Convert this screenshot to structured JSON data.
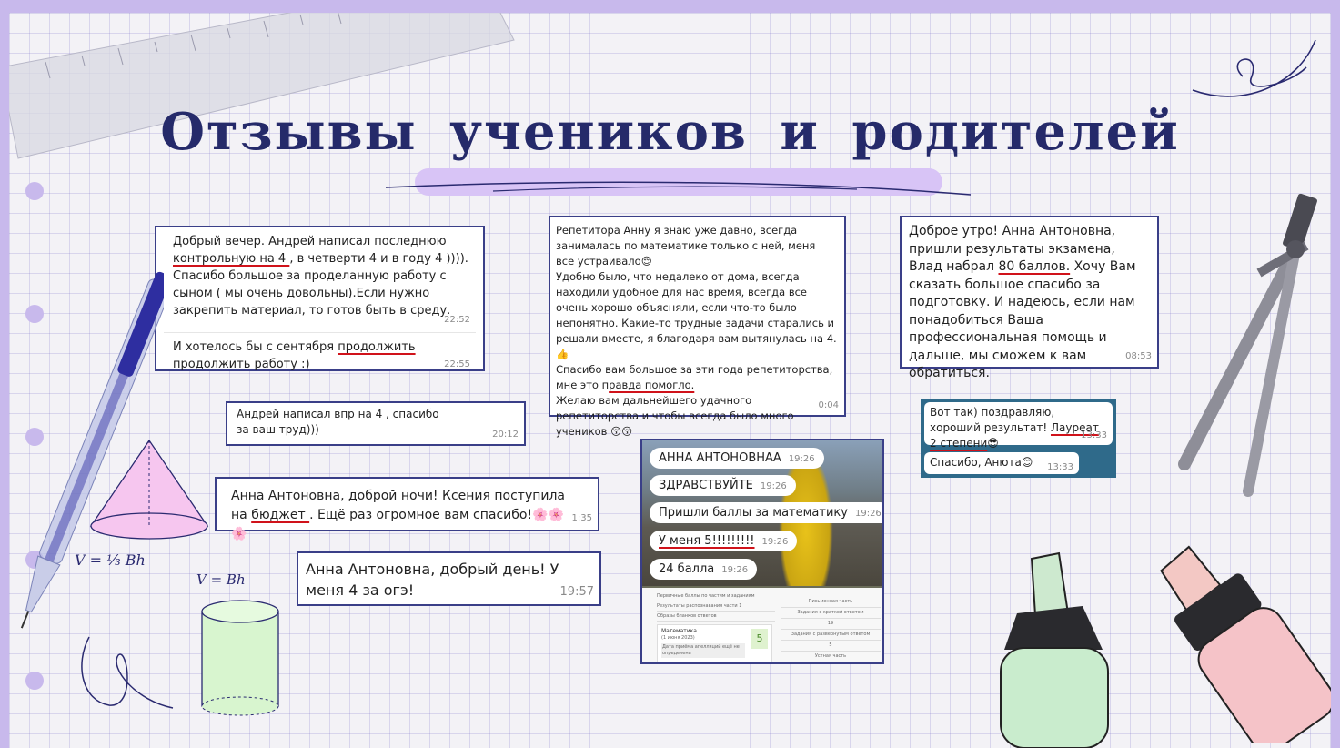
{
  "title": "Отзывы учеников и родителей",
  "formulas": {
    "cone": "V = ⅓ Bh",
    "cylinder": "V = Bh"
  },
  "reviews": {
    "r1": {
      "part1": "Добрый вечер. Андрей написал последнюю ",
      "underlined": "контрольную на 4 ",
      "part2": ", в четверти 4 и в году 4 )))).",
      "part3": "Спасибо большое за проделанную работу с сыном ( мы очень довольны).Если нужно закрепить материал, то готов быть в среду.",
      "time": "22:52"
    },
    "r1b": {
      "part1": "И хотелось бы с сентября ",
      "underlined": "продолжить",
      "part2": "продолжить работу :)",
      "time": "22:55"
    },
    "r2": {
      "text": "Андрей написал впр на 4 , спасибо за ваш труд)))",
      "time": "20:12"
    },
    "r3": {
      "part1": "Анна Антоновна, доброй ночи! Ксения поступила на ",
      "underlined": "бюджет ",
      "part2": ". Ещё раз огромное вам спасибо!🌸🌸🌸",
      "time": "1:35"
    },
    "r4": {
      "text": "Анна Антоновна, добрый день! У меня 4 за огэ!",
      "time": "19:57"
    },
    "r5": {
      "part1": "Репетитора Анну я знаю уже давно, всегда занималась по математике только с ней, меня все устраивало😌",
      "part2": "Удобно было, что недалеко от дома, всегда находили удобное для нас время, всегда все очень хорошо объясняли, если что-то было непонятно. Какие-то трудные задачи старались и решали вместе, я благодаря вам вытянулась на 4. 👍",
      "part3": "Спасибо вам большое за эти года репетиторства, мне это п",
      "underlined": "равда помогло.",
      "part4": "Желаю вам дальнейшего удачного репетиторства и чтобы всегда было много учеников 😚😚",
      "time": "0:04"
    },
    "r6": {
      "part1": "Доброе утро! Анна Антоновна, пришли результаты экзамена, Влад набрал ",
      "underlined": "80 баллов.",
      "part2": " Хочу Вам сказать большое спасибо за подготовку. И надеюсь, если нам понадобиться Ваша профессиональная помощь и дальше, мы сможем к вам обратиться.",
      "time": "08:53"
    },
    "r7": {
      "part1": "Вот  так)  поздравляю, хороший результат! ",
      "underlined": "Лауреат 2  степени",
      "part2": "😎",
      "time": "13:33",
      "reply": "Спасибо,  Анюта😊",
      "reply_time": "13:33"
    },
    "r8": {
      "messages": [
        {
          "text": "АННА АНТОНОВНАА",
          "time": "19:26"
        },
        {
          "text": "ЗДРАВСТВУЙТЕ",
          "time": "19:26"
        },
        {
          "text": "Пришли баллы за математику",
          "time": "19:26"
        },
        {
          "text": "У меня 5!!!!!!!!!",
          "time": "19:26"
        },
        {
          "text": "24 балла",
          "time": "19:26"
        }
      ],
      "table_left": [
        "Первичные баллы по частям и заданиям",
        "Результаты распознавания части 1",
        "Образы бланков ответов"
      ],
      "subject": "Математика",
      "subject_date": "(1 июня 2023)",
      "appeal": "Дата приёма апелляций ещё не определена",
      "grade": "5",
      "table_right": [
        "Письменная часть",
        "Задания с краткой ответом",
        "19",
        "Задания с развёрнутым ответом",
        "5",
        "Устная часть"
      ]
    }
  }
}
